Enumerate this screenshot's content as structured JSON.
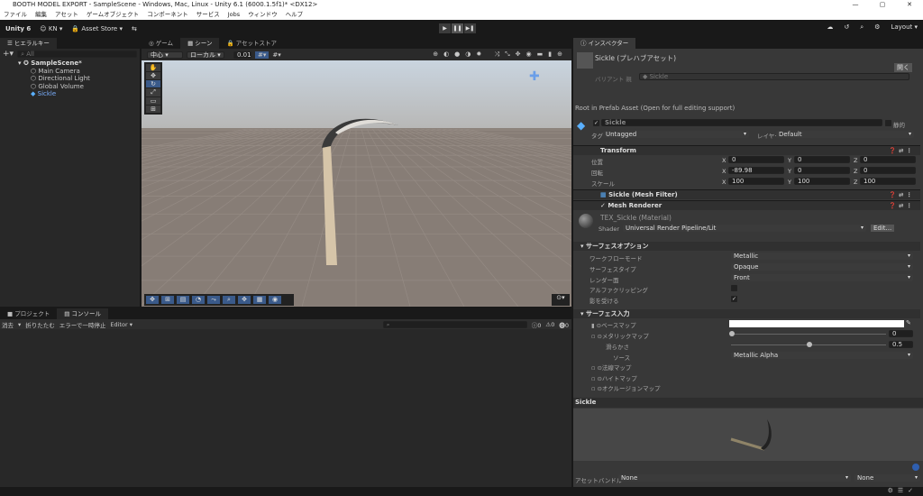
{
  "window": {
    "title": "BOOTH MODEL EXPORT - SampleScene - Windows, Mac, Linux - Unity 6.1 (6000.1.5f1)* <DX12>",
    "controls": [
      "—",
      "▢",
      "✕"
    ]
  },
  "menu": [
    "ファイル",
    "編集",
    "アセット",
    "ゲームオブジェクト",
    "コンポーネント",
    "サービス",
    "Jobs",
    "ウィンドウ",
    "ヘルプ"
  ],
  "toolbar": {
    "unity": "Unity 6",
    "account": "KN ▾",
    "asset_store": "Asset Store ▾",
    "play": "▶",
    "pause": "❚❚",
    "step": "▶❚",
    "layout": "Layout ▾"
  },
  "hierarchy": {
    "tab": "ヒエラルキー",
    "search_placeholder": "All",
    "scene": "SampleScene*",
    "items": [
      "Main Camera",
      "Directional Light",
      "Global Volume",
      "Sickle"
    ]
  },
  "scene_tabs": [
    "ゲーム",
    "シーン",
    "アセットストア"
  ],
  "scene_toolbar": {
    "pivot": "中心 ▾",
    "space": "ローカル ▾",
    "snap": "0.01"
  },
  "bottom": {
    "tabs": [
      "プロジェクト",
      "コンソール"
    ],
    "buttons": [
      "消去",
      "▾",
      "折りたたむ",
      "エラーで一時停止",
      "Editor ▾"
    ],
    "counts": {
      "info": "0",
      "warn": "0",
      "error": "0"
    }
  },
  "inspector": {
    "tab": "インスペクター",
    "asset_title": "Sickle (プレハブアセット)",
    "open": "開く",
    "variant_label": "バリアント 親",
    "variant_value": "Sickle",
    "root_note": "Root in Prefab Asset (Open for full editing support)",
    "name": "Sickle",
    "static": "静的",
    "tag_label": "タグ",
    "tag": "Untagged",
    "layer_label": "レイヤー",
    "layer": "Default",
    "transform": {
      "title": "Transform",
      "rows": [
        {
          "label": "位置",
          "x": "0",
          "y": "0",
          "z": "0"
        },
        {
          "label": "回転",
          "x": "-89.98",
          "y": "0",
          "z": "0"
        },
        {
          "label": "スケール",
          "x": "100",
          "y": "100",
          "z": "100"
        }
      ]
    },
    "mesh_filter": "Sickle (Mesh Filter)",
    "mesh_renderer": "Mesh Renderer",
    "material": {
      "name": "TEX_Sickle (Material)",
      "shader_label": "Shader",
      "shader": "Universal Render Pipeline/Lit",
      "edit": "Edit..."
    },
    "surface_options": {
      "title": "サーフェスオプション",
      "rows": [
        {
          "label": "ワークフローモード",
          "value": "Metallic"
        },
        {
          "label": "サーフェスタイプ",
          "value": "Opaque"
        },
        {
          "label": "レンダー面",
          "value": "Front"
        }
      ],
      "alpha_clip": "アルファクリッピング",
      "receive_shadow": "影を受ける"
    },
    "surface_inputs": {
      "title": "サーフェス入力",
      "base_map": "ベースマップ",
      "metallic_map": "メタリックマップ",
      "metallic": "0",
      "smoothness_label": "滑らかさ",
      "smoothness": "0.5",
      "smoothness_fraction": 0.5,
      "source_label": "ソース",
      "source": "Metallic Alpha",
      "normal_map": "法線マップ",
      "height_map": "ハイトマップ",
      "occlusion_map": "オクルージョンマップ"
    },
    "preview_title": "Sickle",
    "asset_bundle_label": "アセットバンドル",
    "asset_bundle": "None",
    "asset_variant": "None"
  },
  "colors": {
    "accent": "#4c7fbf",
    "selected_text": "#7bb0ff"
  }
}
